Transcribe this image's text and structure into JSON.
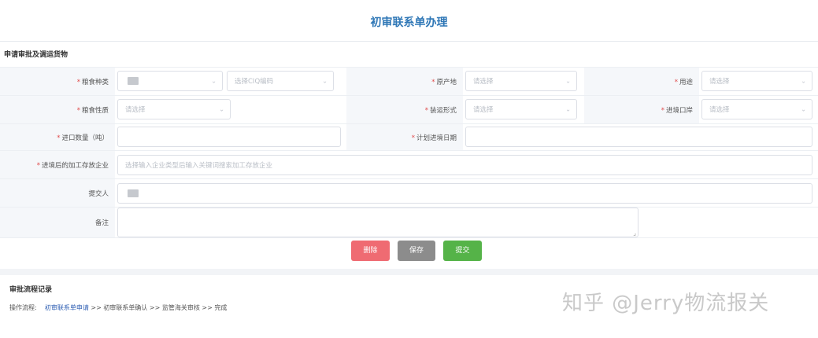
{
  "page_title": "初审联系单办理",
  "section_title": "申请审批及调运货物",
  "fields": {
    "grain_type": {
      "label": "粮食种类",
      "required": true,
      "select2_placeholder": "选择CIQ编码"
    },
    "origin": {
      "label": "原产地",
      "required": true,
      "placeholder": "请选择"
    },
    "usage": {
      "label": "用途",
      "required": true,
      "placeholder": "请选择"
    },
    "grain_nature": {
      "label": "粮食性质",
      "required": true,
      "placeholder": "请选择"
    },
    "packaging": {
      "label": "装运形式",
      "required": true,
      "placeholder": "请选择"
    },
    "entry_port": {
      "label": "进境口岸",
      "required": true,
      "placeholder": "请选择"
    },
    "import_quantity": {
      "label": "进口数量（吨）",
      "required": true,
      "value": ""
    },
    "planned_entry_date": {
      "label": "计划进境日期",
      "required": true,
      "value": ""
    },
    "processing_company": {
      "label": "进境后的加工存放企业",
      "required": true,
      "placeholder": "选择输入企业类型后输入关键词搜索加工存放企业"
    },
    "submitter": {
      "label": "提交人",
      "required": false
    },
    "remarks": {
      "label": "备注",
      "required": false,
      "value": ""
    }
  },
  "buttons": {
    "delete": "删除",
    "save": "保存",
    "submit": "提交"
  },
  "flow": {
    "title": "审批流程记录",
    "prefix": "操作流程:",
    "steps": [
      "初审联系单申请",
      "初审联系单确认",
      "监管海关审核",
      "完成"
    ],
    "separator": ">>",
    "active_step": "初审联系单申请"
  },
  "watermark": "知乎 @Jerry物流报关",
  "colors": {
    "title": "#2f77b6",
    "required_mark": "#e04a4a",
    "delete_button": "#ef6b72",
    "save_button": "#8c8c8c",
    "submit_button": "#55b348",
    "active_step": "#2f5fb3"
  },
  "icons": {
    "select_arrow": "chevron-down-icon",
    "resize_handle": "resize-grip-icon"
  }
}
